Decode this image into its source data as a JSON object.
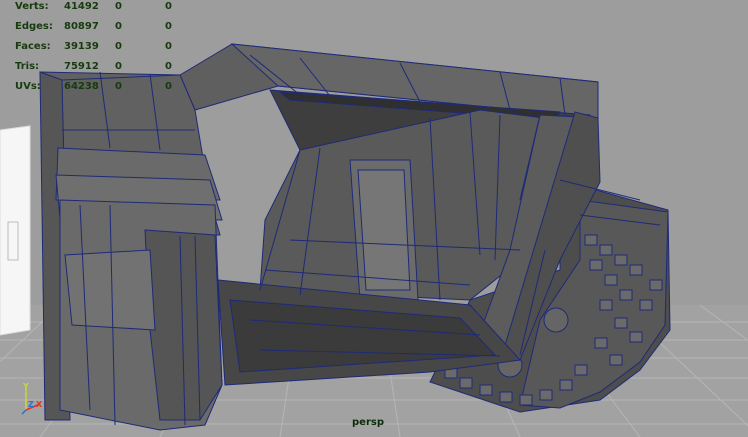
{
  "viewport": {
    "camera": "persp"
  },
  "hud": {
    "rows": [
      {
        "label": "Verts:",
        "values": [
          "41492",
          "0",
          "0"
        ]
      },
      {
        "label": "Edges:",
        "values": [
          "80897",
          "0",
          "0"
        ]
      },
      {
        "label": "Faces:",
        "values": [
          "39139",
          "0",
          "0"
        ]
      },
      {
        "label": "Tris:",
        "values": [
          "75912",
          "0",
          "0"
        ]
      },
      {
        "label": "UVs:",
        "values": [
          "64238",
          "0",
          "0"
        ]
      }
    ]
  },
  "axis": {
    "y": "Y",
    "z": "Z",
    "x": "X"
  },
  "colors": {
    "background": "#9d9d9d",
    "grid": "#b4b4b4",
    "wire": "#1e2a78",
    "mesh_face": "#5c5c5c",
    "hud_text": "#163b0e",
    "axis_x": "#e0342c",
    "axis_y": "#c8d73a",
    "axis_z": "#2a6ed8"
  }
}
